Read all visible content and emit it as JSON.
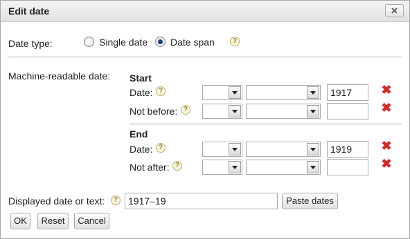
{
  "dialog": {
    "title": "Edit date",
    "close_icon": "close-icon",
    "close_glyph": "✕"
  },
  "date_type": {
    "label": "Date type:",
    "options": [
      {
        "label": "Single date",
        "selected": false
      },
      {
        "label": "Date span",
        "selected": true
      }
    ]
  },
  "help_glyph": "?",
  "delete_glyph": "✖",
  "machine_readable": {
    "label": "Machine-readable date:",
    "start": {
      "heading": "Start",
      "date": {
        "label": "Date:",
        "day": "",
        "month": "",
        "year": "1917"
      },
      "not_before": {
        "label": "Not before:",
        "day": "",
        "month": "",
        "year": ""
      }
    },
    "end": {
      "heading": "End",
      "date": {
        "label": "Date:",
        "day": "",
        "month": "",
        "year": "1919"
      },
      "not_after": {
        "label": "Not after:",
        "day": "",
        "month": "",
        "year": ""
      }
    }
  },
  "displayed": {
    "label": "Displayed date or text:",
    "value": "1917–19",
    "paste_label": "Paste dates"
  },
  "footer": {
    "ok_label": "OK",
    "reset_label": "Reset",
    "cancel_label": "Cancel"
  },
  "colors": {
    "delete": "#d42a2a",
    "radio_selected": "#1c3f7a"
  }
}
